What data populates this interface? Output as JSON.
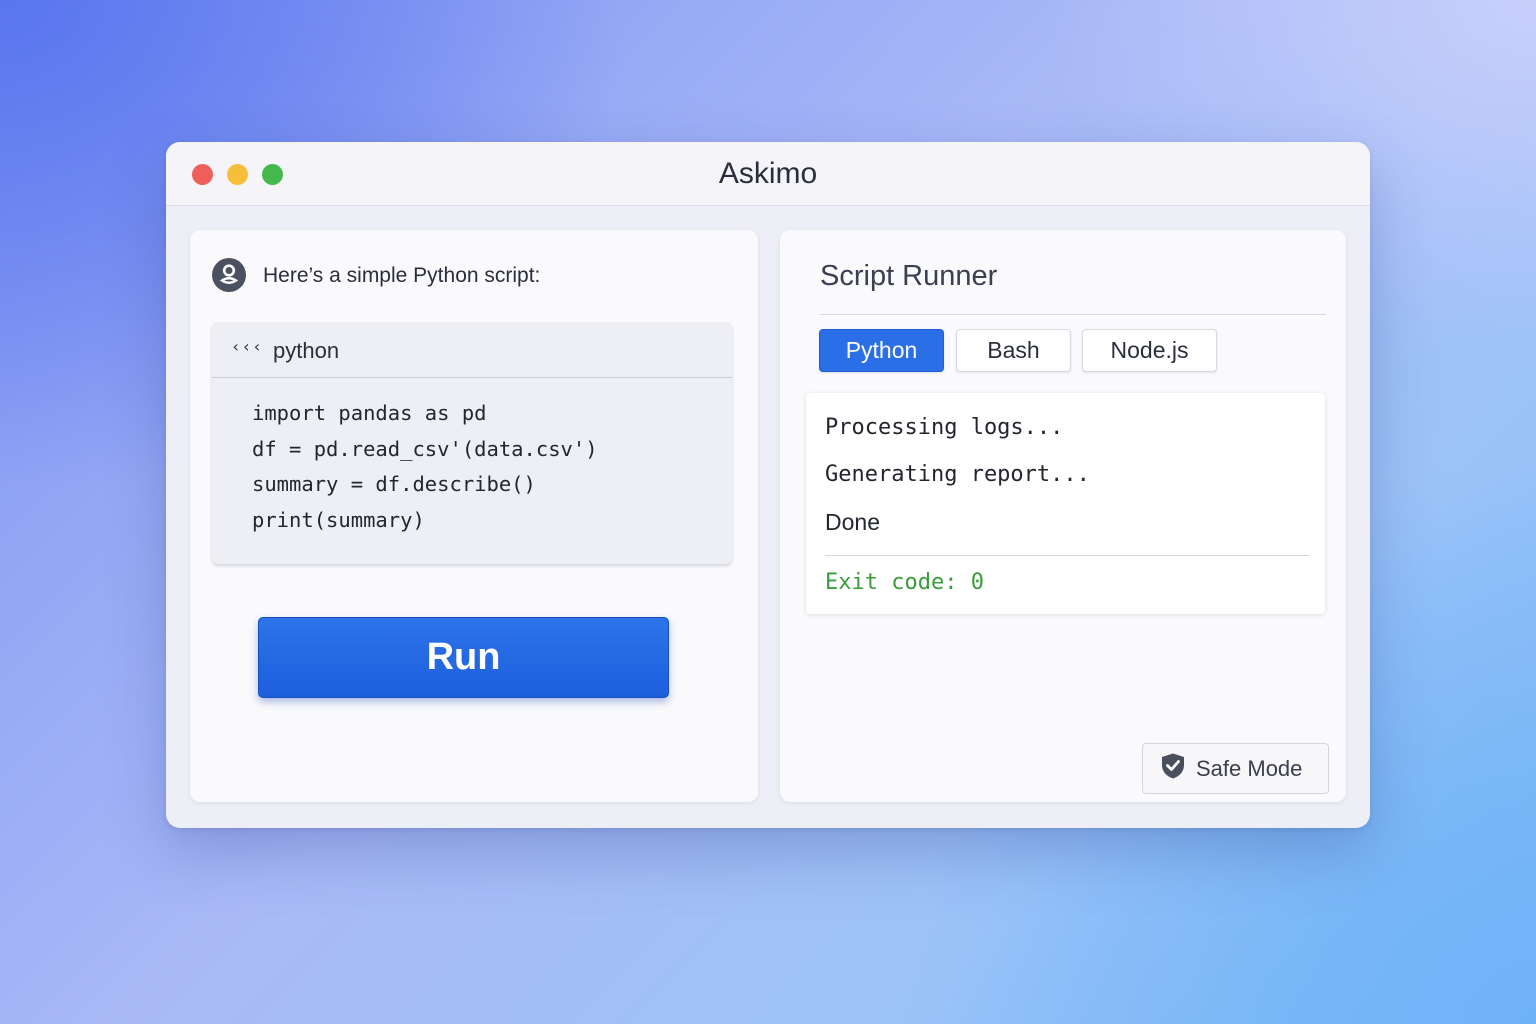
{
  "window": {
    "title": "Askimo"
  },
  "chat": {
    "intro": "Here’s a simple Python script:",
    "code": {
      "language": "python",
      "lines": [
        "import pandas as pd",
        "df = pd.read_csv'(data.csv')",
        "summary = df.describe()",
        "print(summary)"
      ]
    },
    "run_label": "Run"
  },
  "runner": {
    "title": "Script Runner",
    "tabs": [
      {
        "label": "Python",
        "active": true
      },
      {
        "label": "Bash",
        "active": false
      },
      {
        "label": "Node.js",
        "active": false
      }
    ],
    "output": [
      "Processing logs...",
      "Generating report...",
      "Done"
    ],
    "exit_code": "Exit code: 0",
    "safe_mode_label": "Safe Mode"
  },
  "colors": {
    "accent": "#2a6fe6",
    "success": "#3a9c3a",
    "close": "#ee5f59",
    "minimize": "#f7be3b",
    "zoom": "#44b84a"
  },
  "icons": {
    "assistant_avatar": "assistant-icon",
    "code_collapse": "chevrons-icon",
    "safe_mode": "shield-check-icon"
  }
}
